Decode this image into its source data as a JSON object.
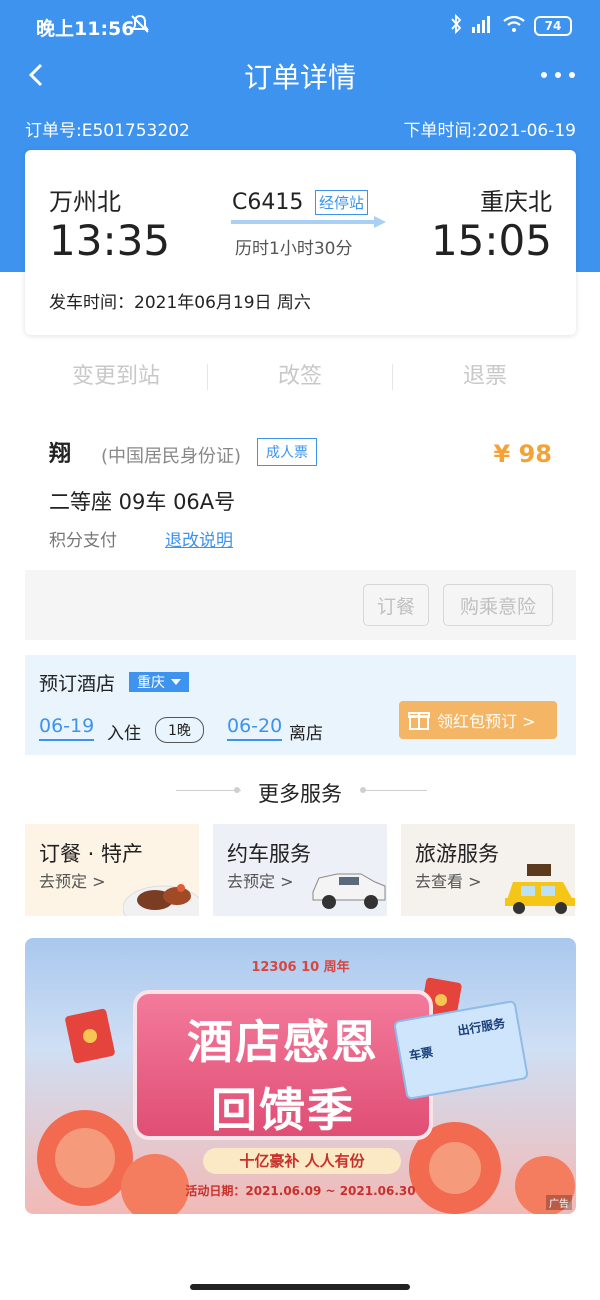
{
  "status_bar": {
    "time": "晚上11:56",
    "battery": "74"
  },
  "header": {
    "title": "订单详情"
  },
  "order": {
    "number": "订单号:E501753202",
    "order_time": "下单时间:2021-06-19"
  },
  "trip": {
    "from_station": "万州北",
    "depart_time": "13:35",
    "train_no": "C6415",
    "stops_link": "经停站",
    "duration": "历时1小时30分",
    "to_station": "重庆北",
    "arrive_time": "15:05",
    "depart_date": "发车时间：2021年06月19日 周六"
  },
  "actions": [
    "变更到站",
    "改签",
    "退票"
  ],
  "passenger": {
    "name": "翔",
    "id_type": "(中国居民身份证)",
    "ticket_type": "成人票",
    "price": "¥ 98",
    "seat": "二等座 09车 06A号",
    "payment": "积分支付",
    "rules_link": "退改说明",
    "buttons": [
      "订餐",
      "购乘意险"
    ]
  },
  "hotel": {
    "title": "预订酒店",
    "city": "重庆",
    "checkin_date": "06-19",
    "checkin_label": "入住",
    "nights": "1晚",
    "checkout_date": "06-20",
    "checkout_label": "离店",
    "coupon_button": "领红包预订 >"
  },
  "more_services": {
    "title": "更多服务",
    "items": [
      {
        "title": "订餐 · 特产",
        "sub": "去预定 >"
      },
      {
        "title": "约车服务",
        "sub": "去预定 >"
      },
      {
        "title": "旅游服务",
        "sub": "去查看 >"
      }
    ]
  },
  "banner": {
    "top_text": "12306 10 周年",
    "line1": "酒店感恩",
    "line2": "回馈季",
    "slogan": "十亿豪补 人人有份",
    "dates": "活动日期：2021.06.09 ~ 2021.06.30",
    "ticket_left": "车票",
    "ticket_right": "出行服务",
    "ad_label": "广告"
  }
}
